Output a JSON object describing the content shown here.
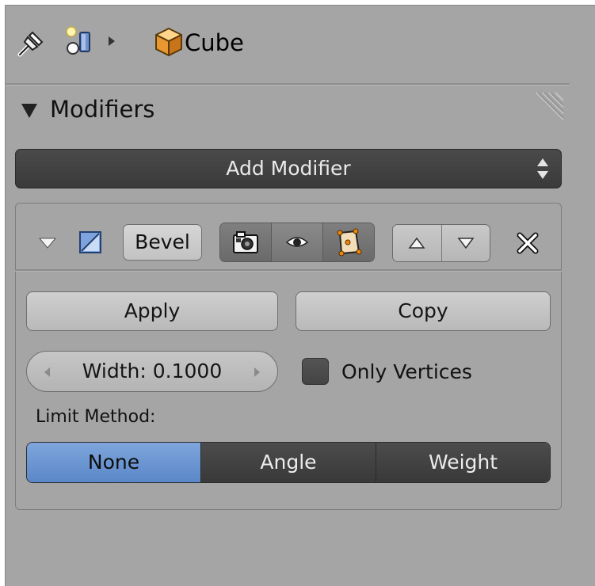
{
  "breadcrumb": {
    "object_name": "Cube",
    "icons": [
      "pin-icon",
      "scene-icon",
      "breadcrumb-arrow-icon",
      "cube-icon"
    ]
  },
  "panel": {
    "title": "Modifiers"
  },
  "add_modifier": {
    "label": "Add Modifier"
  },
  "modifier": {
    "name": "Bevel",
    "type_icon": "bevel-modifier-icon",
    "visibility_icons": [
      "camera-render-icon",
      "eye-view-icon",
      "editmode-icon"
    ],
    "move_icons": [
      "move-up-icon",
      "move-down-icon"
    ],
    "remove_icon": "close-icon",
    "apply_label": "Apply",
    "copy_label": "Copy",
    "width_field": "Width: 0.1000",
    "only_vertices_label": "Only Vertices",
    "only_vertices_checked": false,
    "limit_method_label": "Limit Method:",
    "limit_method_options": [
      "None",
      "Angle",
      "Weight"
    ],
    "limit_method_selected": "None"
  },
  "colors": {
    "background": "#a5a5a5",
    "dark_button": "#3f3f3f",
    "selected_accent": "#6b97d4"
  }
}
